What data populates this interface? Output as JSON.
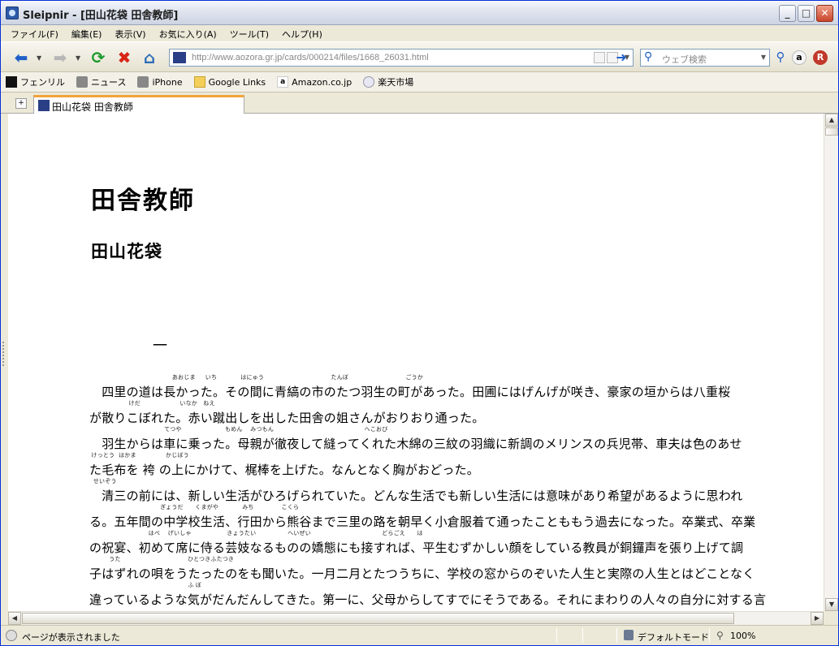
{
  "window": {
    "title": "Sleipnir - [田山花袋 田舎教師]"
  },
  "menu": [
    "ファイル(F)",
    "編集(E)",
    "表示(V)",
    "お気に入り(A)",
    "ツール(T)",
    "ヘルプ(H)"
  ],
  "address": {
    "url": "http://www.aozora.gr.jp/cards/000214/files/1668_26031.html"
  },
  "search": {
    "placeholder": "ウェブ検索"
  },
  "links": [
    {
      "label": "フェンリル",
      "icon": "fenrir-icon"
    },
    {
      "label": "ニュース",
      "icon": "rss-icon"
    },
    {
      "label": "iPhone",
      "icon": "rss-icon"
    },
    {
      "label": "Google Links",
      "icon": "folder-icon"
    },
    {
      "label": "Amazon.co.jp",
      "icon": "amazon-icon"
    },
    {
      "label": "楽天市場",
      "icon": "rakuten-icon"
    }
  ],
  "tab": {
    "label": "田山花袋 田舎教師"
  },
  "document": {
    "title": "田舎教師",
    "author": "田山花袋",
    "chapter": "一",
    "lines": [
      {
        "text": "　四里の道は長かった。その間に青縞の市のたつ羽生の町があった。田圃にはげんげが咲き、豪家の垣からは八重桜",
        "ruby": "                                          あおじま     いち            はにゅう                                  たんぼ                             ごうか"
      },
      {
        "text": "が散りこぼれた。赤い蹴出しを出した田舎の姐さんがおりおり通った。",
        "ruby": "                    けだ                    いなか   ねえ"
      },
      {
        "text": "　羽生からは車に乗った。母親が徹夜して縫ってくれた木綿の三紋の羽織に新調のメリンスの兵児帯、車夫は色のあせ",
        "ruby": "                                      てつや                      もめん    みつもん                                              へこおび"
      },
      {
        "text": "た毛布を 袴 の上にかけて、梶棒を上げた。なんとなく胸がおどった。",
        "ruby": " けっとう  はかま               かじぼう"
      },
      {
        "text": "　清三の前には、新しい生活がひろげられていた。どんな生活でも新しい生活には意味があり希望があるように思われ",
        "ruby": "  せいぞう"
      },
      {
        "text": "る。五年間の中学校生活、行田から熊谷まで三里の路を朝早く小倉服着て通ったことももう過去になった。卒業式、卒業",
        "ruby": "                                    ぎょうだ      くまがや            みち              こくら"
      },
      {
        "text": "の祝宴、初めて席に侍る芸妓なるものの嬌態にも接すれば、平生むずかしい顔をしている教員が銅鑼声を張り上げて調",
        "ruby": "                              はべ    げいしゃ                  きょうたい                へいぜい                                    どらごえ      は"
      },
      {
        "text": "子はずれの唄をうたったのをも聞いた。一月二月とたつうちに、学校の窓からのぞいた人生と実際の人生とはどことなく",
        "ruby": "          うた                                  ひとつきふたつき"
      },
      {
        "text": "違っているような気がだんだんしてきた。第一に、父母からしてすでにそうである。それにまわりの人々の自分に対する言",
        "ruby": "                                                  ふ ぼ"
      }
    ]
  },
  "status": {
    "text": "ページが表示されました",
    "mode": "デフォルトモード",
    "zoom": "100%"
  },
  "colors": {
    "tab_accent": "#f2a33a",
    "link_blue": "#1f5fc8"
  }
}
